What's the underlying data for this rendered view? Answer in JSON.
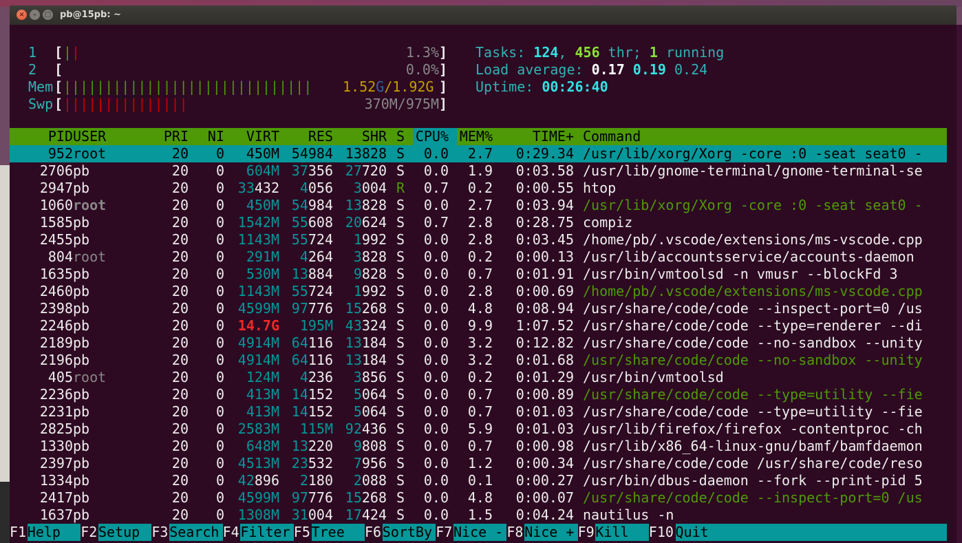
{
  "window": {
    "title": "pb@15pb: ~",
    "buttons": [
      "×",
      "–",
      "□"
    ]
  },
  "meters": {
    "cpu1": {
      "label": "1",
      "bars": "||",
      "value": "1.3%"
    },
    "cpu2": {
      "label": "2",
      "bars": "",
      "value": "0.0%"
    },
    "mem": {
      "label": "Mem",
      "bars": "||||||||||||||||||||||||||||||",
      "used": "1.52",
      "used_unit": "G",
      "sep": "/",
      "total": "1.92G"
    },
    "swp": {
      "label": "Swp",
      "bars": "|||||||||||||||",
      "value": "370M/975M"
    }
  },
  "summary": {
    "tasks_label": "Tasks: ",
    "tasks": "124",
    "sep1": ", ",
    "threads": "456",
    "thr_label": " thr; ",
    "running": "1",
    "running_label": " running",
    "load_label": "Load average: ",
    "load1": "0.17",
    "load5": "0.19",
    "load15": "0.24",
    "uptime_label": "Uptime: ",
    "uptime": "00:26:40"
  },
  "columns": [
    "PID",
    "USER",
    "PRI",
    "NI",
    "VIRT",
    "RES",
    "SHR",
    "S",
    "CPU%",
    "MEM%",
    "TIME+",
    "Command"
  ],
  "processes": [
    {
      "pid": "952",
      "user": "root",
      "pri": "20",
      "ni": "0",
      "virt": "450M",
      "res": "54984",
      "shr": "13828",
      "s": "S",
      "cpu": "0.0",
      "mem": "2.7",
      "time": "0:29.34",
      "cmd": "/usr/lib/xorg/Xorg -core :0 -seat seat0 -"
    },
    {
      "pid": "2706",
      "user": "pb",
      "pri": "20",
      "ni": "0",
      "virt": "604M",
      "res": "37356",
      "shr": "27720",
      "s": "S",
      "cpu": "0.0",
      "mem": "1.9",
      "time": "0:03.58",
      "cmd": "/usr/lib/gnome-terminal/gnome-terminal-se"
    },
    {
      "pid": "2947",
      "user": "pb",
      "pri": "20",
      "ni": "0",
      "virt": "33432",
      "res": "4056",
      "shr": "3004",
      "s": "R",
      "cpu": "0.7",
      "mem": "0.2",
      "time": "0:00.55",
      "cmd": "htop"
    },
    {
      "pid": "1060",
      "user": "root",
      "pri": "20",
      "ni": "0",
      "virt": "450M",
      "res": "54984",
      "shr": "13828",
      "s": "S",
      "cpu": "0.0",
      "mem": "2.7",
      "time": "0:03.94",
      "cmd": "/usr/lib/xorg/Xorg -core :0 -seat seat0 -"
    },
    {
      "pid": "1585",
      "user": "pb",
      "pri": "20",
      "ni": "0",
      "virt": "1542M",
      "res": "55608",
      "shr": "20624",
      "s": "S",
      "cpu": "0.7",
      "mem": "2.8",
      "time": "0:28.75",
      "cmd": "compiz"
    },
    {
      "pid": "2455",
      "user": "pb",
      "pri": "20",
      "ni": "0",
      "virt": "1143M",
      "res": "55724",
      "shr": "1992",
      "s": "S",
      "cpu": "0.0",
      "mem": "2.8",
      "time": "0:03.45",
      "cmd": "/home/pb/.vscode/extensions/ms-vscode.cpp"
    },
    {
      "pid": "804",
      "user": "root",
      "pri": "20",
      "ni": "0",
      "virt": "291M",
      "res": "4264",
      "shr": "3828",
      "s": "S",
      "cpu": "0.0",
      "mem": "0.2",
      "time": "0:00.13",
      "cmd": "/usr/lib/accountsservice/accounts-daemon"
    },
    {
      "pid": "1635",
      "user": "pb",
      "pri": "20",
      "ni": "0",
      "virt": "530M",
      "res": "13884",
      "shr": "9828",
      "s": "S",
      "cpu": "0.0",
      "mem": "0.7",
      "time": "0:01.91",
      "cmd": "/usr/bin/vmtoolsd -n vmusr --blockFd 3"
    },
    {
      "pid": "2460",
      "user": "pb",
      "pri": "20",
      "ni": "0",
      "virt": "1143M",
      "res": "55724",
      "shr": "1992",
      "s": "S",
      "cpu": "0.0",
      "mem": "2.8",
      "time": "0:00.69",
      "cmd": "/home/pb/.vscode/extensions/ms-vscode.cpp"
    },
    {
      "pid": "2398",
      "user": "pb",
      "pri": "20",
      "ni": "0",
      "virt": "4599M",
      "res": "97776",
      "shr": "15268",
      "s": "S",
      "cpu": "0.0",
      "mem": "4.8",
      "time": "0:08.94",
      "cmd": "/usr/share/code/code --inspect-port=0 /us"
    },
    {
      "pid": "2246",
      "user": "pb",
      "pri": "20",
      "ni": "0",
      "virt": "14.7G",
      "res": "195M",
      "shr": "43324",
      "s": "S",
      "cpu": "0.0",
      "mem": "9.9",
      "time": "1:07.52",
      "cmd": "/usr/share/code/code --type=renderer --di"
    },
    {
      "pid": "2189",
      "user": "pb",
      "pri": "20",
      "ni": "0",
      "virt": "4914M",
      "res": "64116",
      "shr": "13184",
      "s": "S",
      "cpu": "0.0",
      "mem": "3.2",
      "time": "0:12.82",
      "cmd": "/usr/share/code/code --no-sandbox --unity"
    },
    {
      "pid": "2196",
      "user": "pb",
      "pri": "20",
      "ni": "0",
      "virt": "4914M",
      "res": "64116",
      "shr": "13184",
      "s": "S",
      "cpu": "0.0",
      "mem": "3.2",
      "time": "0:01.68",
      "cmd": "/usr/share/code/code --no-sandbox --unity"
    },
    {
      "pid": "405",
      "user": "root",
      "pri": "20",
      "ni": "0",
      "virt": "124M",
      "res": "4236",
      "shr": "3856",
      "s": "S",
      "cpu": "0.0",
      "mem": "0.2",
      "time": "0:01.29",
      "cmd": "/usr/bin/vmtoolsd"
    },
    {
      "pid": "2236",
      "user": "pb",
      "pri": "20",
      "ni": "0",
      "virt": "413M",
      "res": "14152",
      "shr": "5064",
      "s": "S",
      "cpu": "0.0",
      "mem": "0.7",
      "time": "0:00.89",
      "cmd": "/usr/share/code/code --type=utility --fie"
    },
    {
      "pid": "2231",
      "user": "pb",
      "pri": "20",
      "ni": "0",
      "virt": "413M",
      "res": "14152",
      "shr": "5064",
      "s": "S",
      "cpu": "0.0",
      "mem": "0.7",
      "time": "0:01.03",
      "cmd": "/usr/share/code/code --type=utility --fie"
    },
    {
      "pid": "2825",
      "user": "pb",
      "pri": "20",
      "ni": "0",
      "virt": "2583M",
      "res": "115M",
      "shr": "92436",
      "s": "S",
      "cpu": "0.0",
      "mem": "5.9",
      "time": "0:01.03",
      "cmd": "/usr/lib/firefox/firefox -contentproc -ch"
    },
    {
      "pid": "1330",
      "user": "pb",
      "pri": "20",
      "ni": "0",
      "virt": "648M",
      "res": "13220",
      "shr": "9808",
      "s": "S",
      "cpu": "0.0",
      "mem": "0.7",
      "time": "0:00.98",
      "cmd": "/usr/lib/x86_64-linux-gnu/bamf/bamfdaemon"
    },
    {
      "pid": "2397",
      "user": "pb",
      "pri": "20",
      "ni": "0",
      "virt": "4513M",
      "res": "23532",
      "shr": "7956",
      "s": "S",
      "cpu": "0.0",
      "mem": "1.2",
      "time": "0:00.34",
      "cmd": "/usr/share/code/code /usr/share/code/reso"
    },
    {
      "pid": "1334",
      "user": "pb",
      "pri": "20",
      "ni": "0",
      "virt": "42896",
      "res": "2180",
      "shr": "2088",
      "s": "S",
      "cpu": "0.0",
      "mem": "0.1",
      "time": "0:00.27",
      "cmd": "/usr/bin/dbus-daemon --fork --print-pid 5"
    },
    {
      "pid": "2417",
      "user": "pb",
      "pri": "20",
      "ni": "0",
      "virt": "4599M",
      "res": "97776",
      "shr": "15268",
      "s": "S",
      "cpu": "0.0",
      "mem": "4.8",
      "time": "0:00.07",
      "cmd": "/usr/share/code/code --inspect-port=0 /us"
    },
    {
      "pid": "1637",
      "user": "pb",
      "pri": "20",
      "ni": "0",
      "virt": "1308M",
      "res": "31004",
      "shr": "17424",
      "s": "S",
      "cpu": "0.0",
      "mem": "1.5",
      "time": "0:04.24",
      "cmd": "nautilus -n"
    }
  ],
  "function_keys": [
    {
      "key": "F1",
      "label": "Help  "
    },
    {
      "key": "F2",
      "label": "Setup "
    },
    {
      "key": "F3",
      "label": "Search"
    },
    {
      "key": "F4",
      "label": "Filter"
    },
    {
      "key": "F5",
      "label": "Tree  "
    },
    {
      "key": "F6",
      "label": "SortBy"
    },
    {
      "key": "F7",
      "label": "Nice -"
    },
    {
      "key": "F8",
      "label": "Nice +"
    },
    {
      "key": "F9",
      "label": "Kill  "
    },
    {
      "key": "F10",
      "label": "Quit"
    }
  ]
}
